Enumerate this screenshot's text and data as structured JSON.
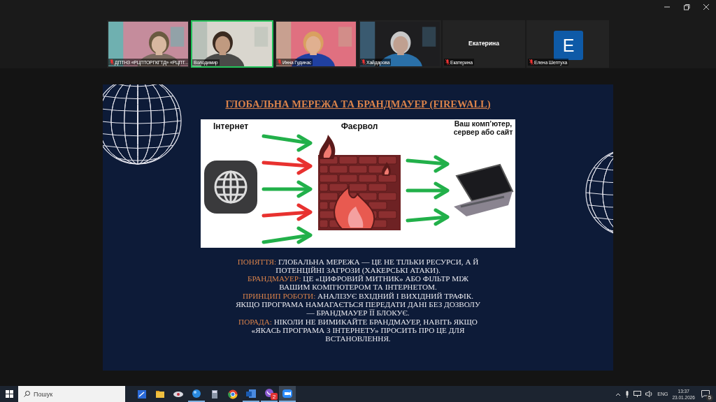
{
  "participants": [
    {
      "kind": "video",
      "name": "ДПТНЗ «РЦПТОРГКГТД» «РЦПТ...",
      "muted": true,
      "speaking": false
    },
    {
      "kind": "video",
      "name": "Володимир",
      "muted": false,
      "speaking": true
    },
    {
      "kind": "video",
      "name": "Инна Гудинас",
      "muted": true,
      "speaking": false
    },
    {
      "kind": "video",
      "name": "Хайдарова",
      "muted": true,
      "speaking": false
    },
    {
      "kind": "name",
      "display": "Екатерина",
      "name": "Екатерина",
      "muted": true,
      "speaking": false
    },
    {
      "kind": "avatar",
      "display": "E",
      "name": "Елена Шептуха",
      "muted": true,
      "speaking": false
    }
  ],
  "slide": {
    "title": "ГЛОБАЛЬНА МЕРЕЖА ТА БРАНДМАУЕР (FIREWALL)",
    "diagram": {
      "left_label": "Інтернет",
      "middle_label": "Фаєрвол",
      "right_label": "Ваш комп’ютер, сервер або сайт"
    },
    "paragraphs": [
      {
        "label": "ПОНЯТТЯ:",
        "text": "ГЛОБАЛЬНА МЕРЕЖА — ЦЕ НЕ ТІЛЬКИ РЕСУРСИ, А Й ПОТЕНЦІЙНІ ЗАГРОЗИ (ХАКЕРСЬКІ АТАКИ)."
      },
      {
        "label": "БРАНДМАУЕР:",
        "text": "ЦЕ «ЦИФРОВИЙ МИТНИК» АБО ФІЛЬТР МІЖ ВАШИМ КОМП'ЮТЕРОМ ТА ІНТЕРНЕТОМ."
      },
      {
        "label": "ПРИНЦИП РОБОТИ:",
        "text": "АНАЛІЗУЄ ВХІДНИЙ І ВИХІДНИЙ ТРАФІК. ЯКЩО ПРОГРАМА НАМАГАЄТЬСЯ ПЕРЕДАТИ ДАНІ БЕЗ ДОЗВОЛУ — БРАНДМАУЕР ЇЇ БЛОКУЄ."
      },
      {
        "label": "ПОРАДА:",
        "text": "НІКОЛИ НЕ ВИМИКАЙТЕ БРАНДМАУЕР, НАВІТЬ ЯКЩО «ЯКАСЬ ПРОГРАМА З ІНТЕРНЕТУ» ПРОСИТЬ ПРО ЦЕ ДЛЯ ВСТАНОВЛЕННЯ."
      }
    ]
  },
  "taskbar": {
    "search": {
      "placeholder": "Пошук"
    },
    "apps": [
      {
        "kind": "pen",
        "running": false,
        "selected": false
      },
      {
        "kind": "folder",
        "running": false,
        "selected": false
      },
      {
        "kind": "disc",
        "running": false,
        "selected": false
      },
      {
        "kind": "ball",
        "running": true,
        "selected": false
      },
      {
        "kind": "calculator",
        "running": false,
        "selected": false
      },
      {
        "kind": "rings",
        "running": false,
        "selected": false
      },
      {
        "kind": "document",
        "running": true,
        "selected": false
      },
      {
        "kind": "phone",
        "running": true,
        "selected": false,
        "badge": "2"
      },
      {
        "kind": "video",
        "running": true,
        "selected": true
      }
    ],
    "language": "ENG",
    "time": "13:37",
    "date": "23.01.2026",
    "notifications": "5"
  }
}
